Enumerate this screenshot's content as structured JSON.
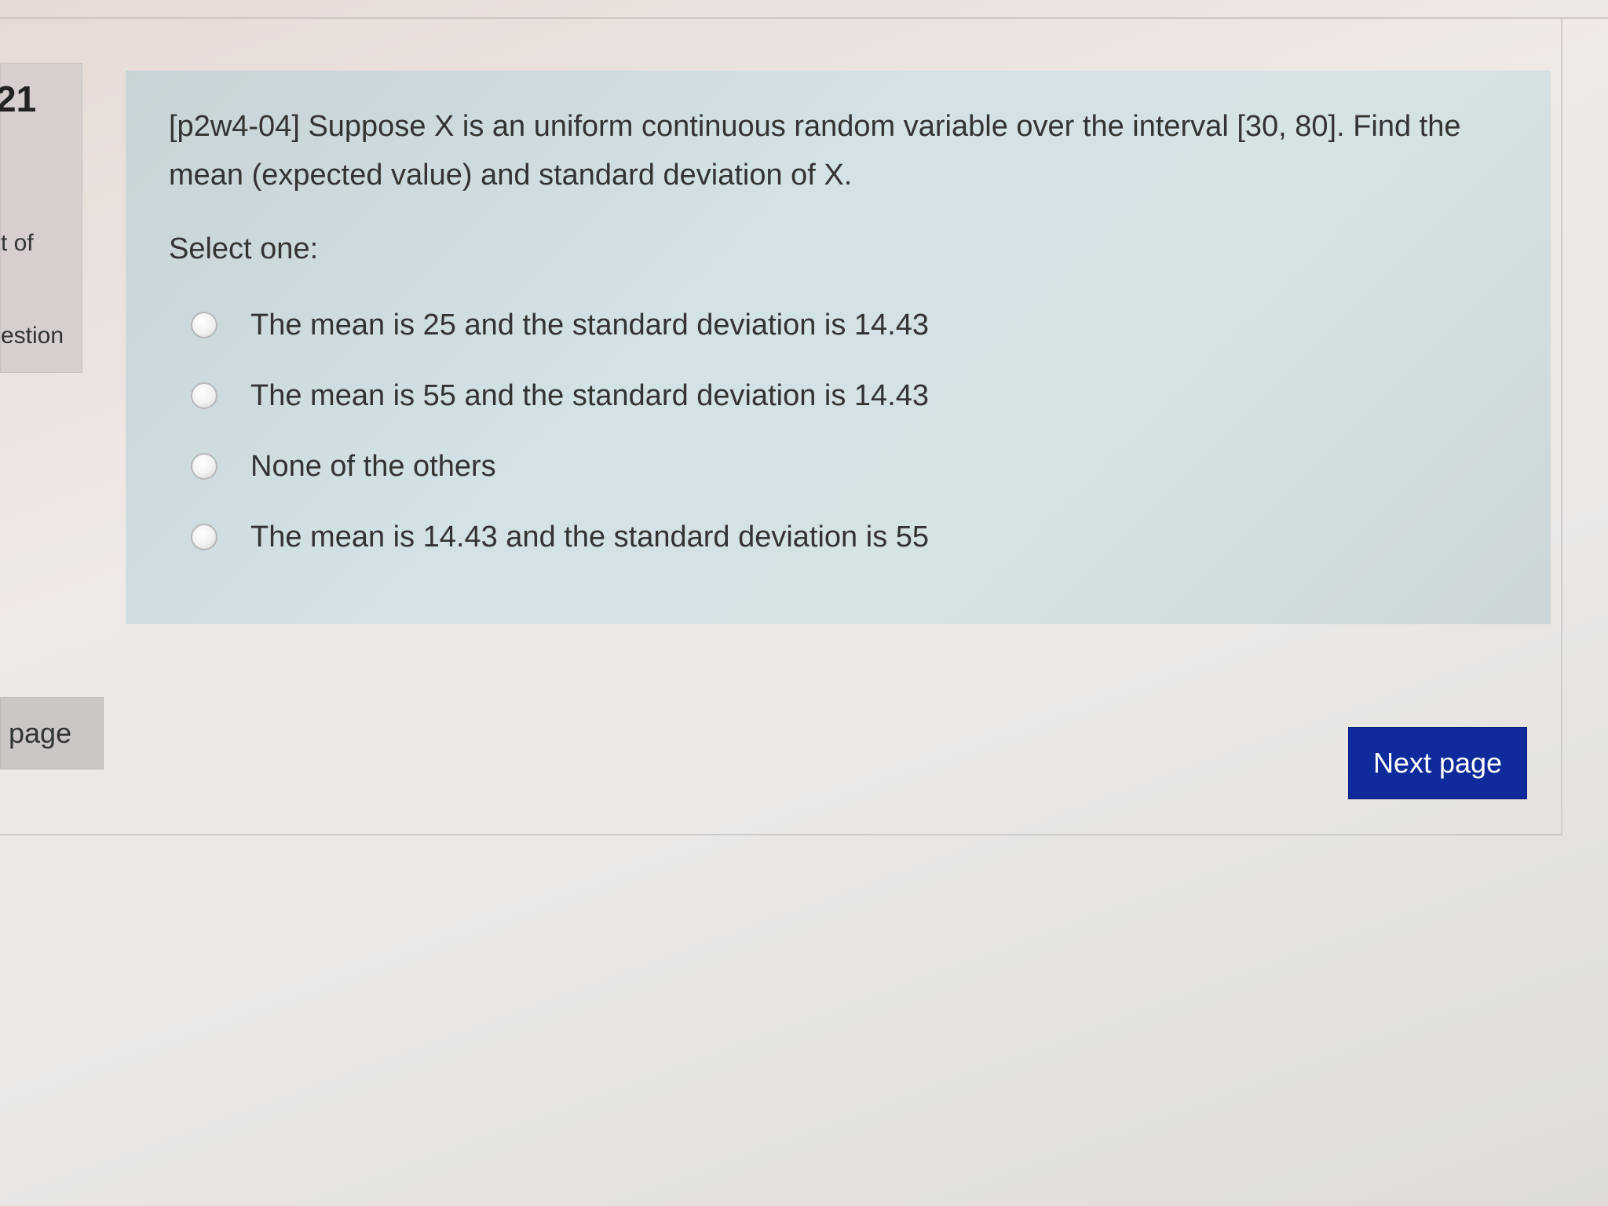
{
  "info": {
    "number": "21",
    "status_line": "t of",
    "flag_line": "estion"
  },
  "question": {
    "text": "[p2w4-04] Suppose X is an uniform continuous random variable over the interval [30, 80]. Find the mean (expected value) and standard deviation of X.",
    "select_label": "Select one:",
    "options": [
      "The mean is 25 and the standard deviation is 14.43",
      "The mean is 55 and the standard deviation is 14.43",
      "None of the others",
      "The mean is 14.43 and the standard deviation is 55"
    ]
  },
  "navigation": {
    "previous_label": "page",
    "next_label": "Next page"
  },
  "colors": {
    "next_button": "#0f2a9a",
    "question_background": "#d2e2e5"
  }
}
